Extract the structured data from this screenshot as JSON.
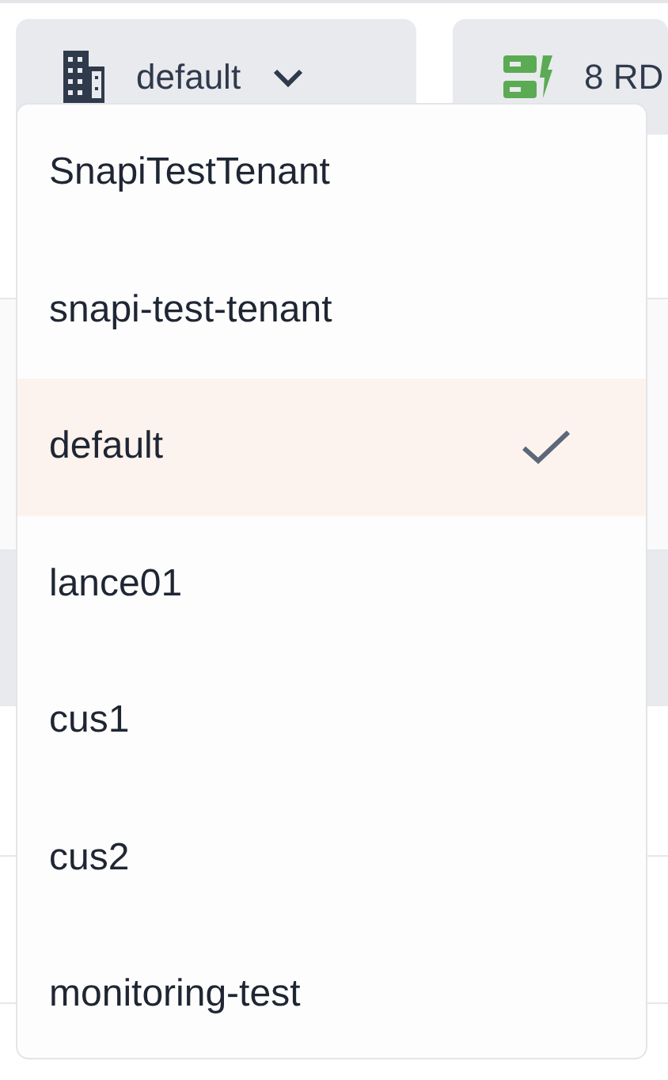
{
  "tenant_button": {
    "label": "default"
  },
  "rds_button": {
    "label": "8 RD"
  },
  "menu": [
    {
      "label": "SnapiTestTenant",
      "selected": false
    },
    {
      "label": "snapi-test-tenant",
      "selected": false
    },
    {
      "label": "default",
      "selected": true
    },
    {
      "label": "lance01",
      "selected": false
    },
    {
      "label": "cus1",
      "selected": false
    },
    {
      "label": "cus2",
      "selected": false
    },
    {
      "label": "monitoring-test",
      "selected": false
    }
  ]
}
